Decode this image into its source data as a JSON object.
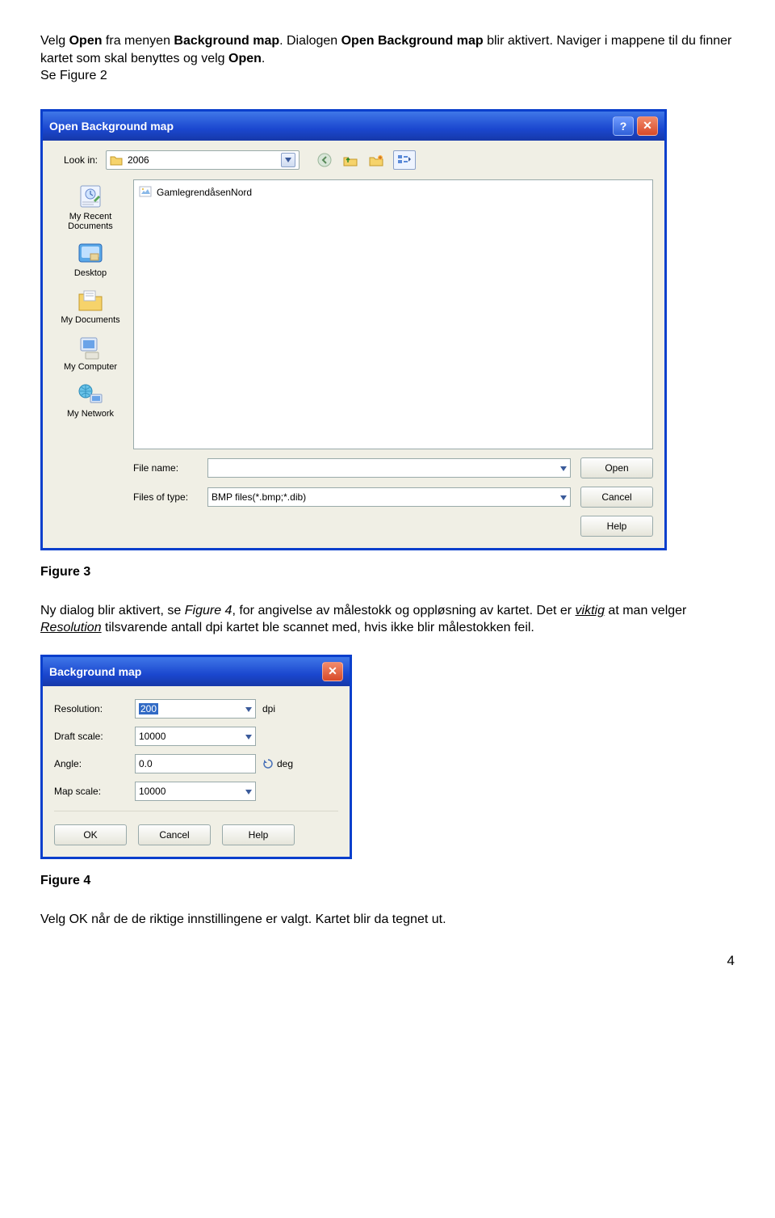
{
  "intro": {
    "t1": "Velg ",
    "open": "Open",
    "t2": " fra menyen ",
    "bgmap": "Background map",
    "t3": ". Dialogen ",
    "dlg": "Open Background map",
    "t4": " blir aktivert. Naviger i mappene til du finner kartet som skal benyttes og velg ",
    "open2": "Open",
    "period": ".",
    "see": "Se Figure 2"
  },
  "fig3": "Figure 3",
  "para2": {
    "t1": "Ny dialog blir aktivert, se ",
    "fig4": "Figure 4",
    "t2": ", for angivelse av målestokk og oppløsning av kartet. Det er ",
    "viktig": "viktig",
    "t3": " at man velger ",
    "res": "Resolution",
    "t4": " tilsvarende antall dpi kartet ble scannet med, hvis ikke blir målestokken feil."
  },
  "dialog1": {
    "title": "Open Background map",
    "lookin_lbl": "Look in:",
    "lookin_val": "2006",
    "file_item": "GamlegrendåsenNord",
    "filename_lbl": "File name:",
    "filename_val": "",
    "filetype_lbl": "Files of type:",
    "filetype_val": "BMP files(*.bmp;*.dib)",
    "btn_open": "Open",
    "btn_cancel": "Cancel",
    "btn_help": "Help",
    "places": [
      "My Recent Documents",
      "Desktop",
      "My Documents",
      "My Computer",
      "My Network"
    ]
  },
  "dialog2": {
    "title": "Background map",
    "resolution_lbl": "Resolution:",
    "resolution_val": "200",
    "resolution_unit": "dpi",
    "draft_lbl": "Draft scale:",
    "draft_val": "10000",
    "angle_lbl": "Angle:",
    "angle_val": "0.0",
    "angle_unit": "deg",
    "map_lbl": "Map scale:",
    "map_val": "10000",
    "btn_ok": "OK",
    "btn_cancel": "Cancel",
    "btn_help": "Help"
  },
  "fig4cap": "Figure 4",
  "outro": "Velg OK når de de riktige innstillingene er valgt. Kartet blir da tegnet ut.",
  "page_num": "4"
}
